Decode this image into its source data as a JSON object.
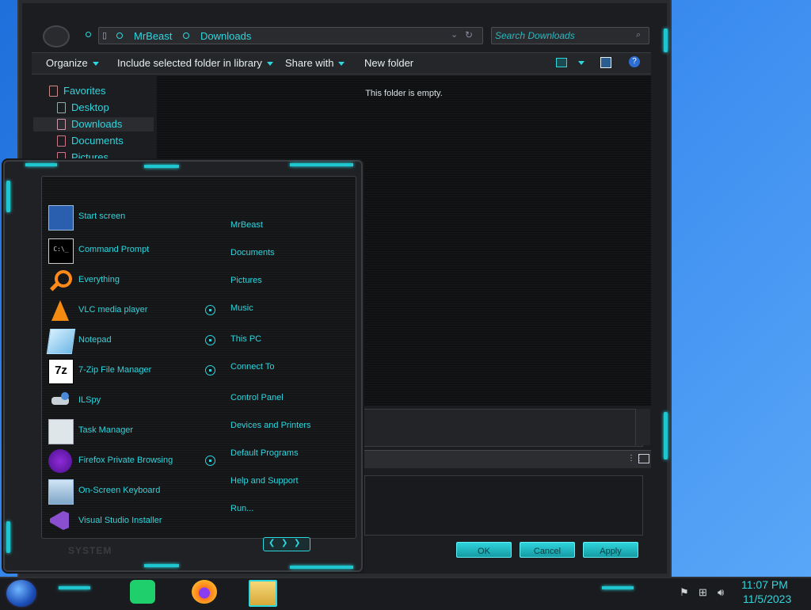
{
  "explorer": {
    "breadcrumb": [
      "MrBeast",
      "Downloads"
    ],
    "search_placeholder": "Search Downloads",
    "toolbar": {
      "organize": "Organize",
      "include_library": "Include selected folder in library",
      "share_with": "Share with",
      "new_folder": "New folder"
    },
    "nav": {
      "favorites": "Favorites",
      "desktop": "Desktop",
      "downloads": "Downloads",
      "documents": "Documents",
      "pictures": "Pictures"
    },
    "empty_message": "This folder is empty.",
    "buttons": {
      "ok": "OK",
      "cancel": "Cancel",
      "apply": "Apply"
    }
  },
  "start_menu": {
    "programs": [
      {
        "label": "Start screen",
        "icon": "start-screen-icon"
      },
      {
        "label": "Command Prompt",
        "icon": "command-prompt-icon"
      },
      {
        "label": "Everything",
        "icon": "magnifier-icon"
      },
      {
        "label": "VLC media player",
        "icon": "vlc-cone-icon"
      },
      {
        "label": "Notepad",
        "icon": "notepad-icon"
      },
      {
        "label": "7-Zip File Manager",
        "icon": "seven-zip-icon"
      },
      {
        "label": "ILSpy",
        "icon": "ilspy-icon"
      },
      {
        "label": "Task Manager",
        "icon": "task-manager-icon"
      },
      {
        "label": "Firefox Private Browsing",
        "icon": "firefox-private-icon"
      },
      {
        "label": "On-Screen Keyboard",
        "icon": "keyboard-icon"
      },
      {
        "label": "Visual Studio Installer",
        "icon": "visual-studio-icon"
      }
    ],
    "places": [
      "MrBeast",
      "Documents",
      "Pictures",
      "Music",
      "This PC",
      "Connect To",
      "Control Panel",
      "Devices and Printers",
      "Default Programs",
      "Help and Support",
      "Run..."
    ],
    "system_label": "SYSTEM"
  },
  "taskbar": {
    "time": "11:07 PM",
    "date": "11/5/2023"
  },
  "colors": {
    "accent": "#2ed6de",
    "glow": "#1fc6cf",
    "chrome": "#1c1d20"
  }
}
